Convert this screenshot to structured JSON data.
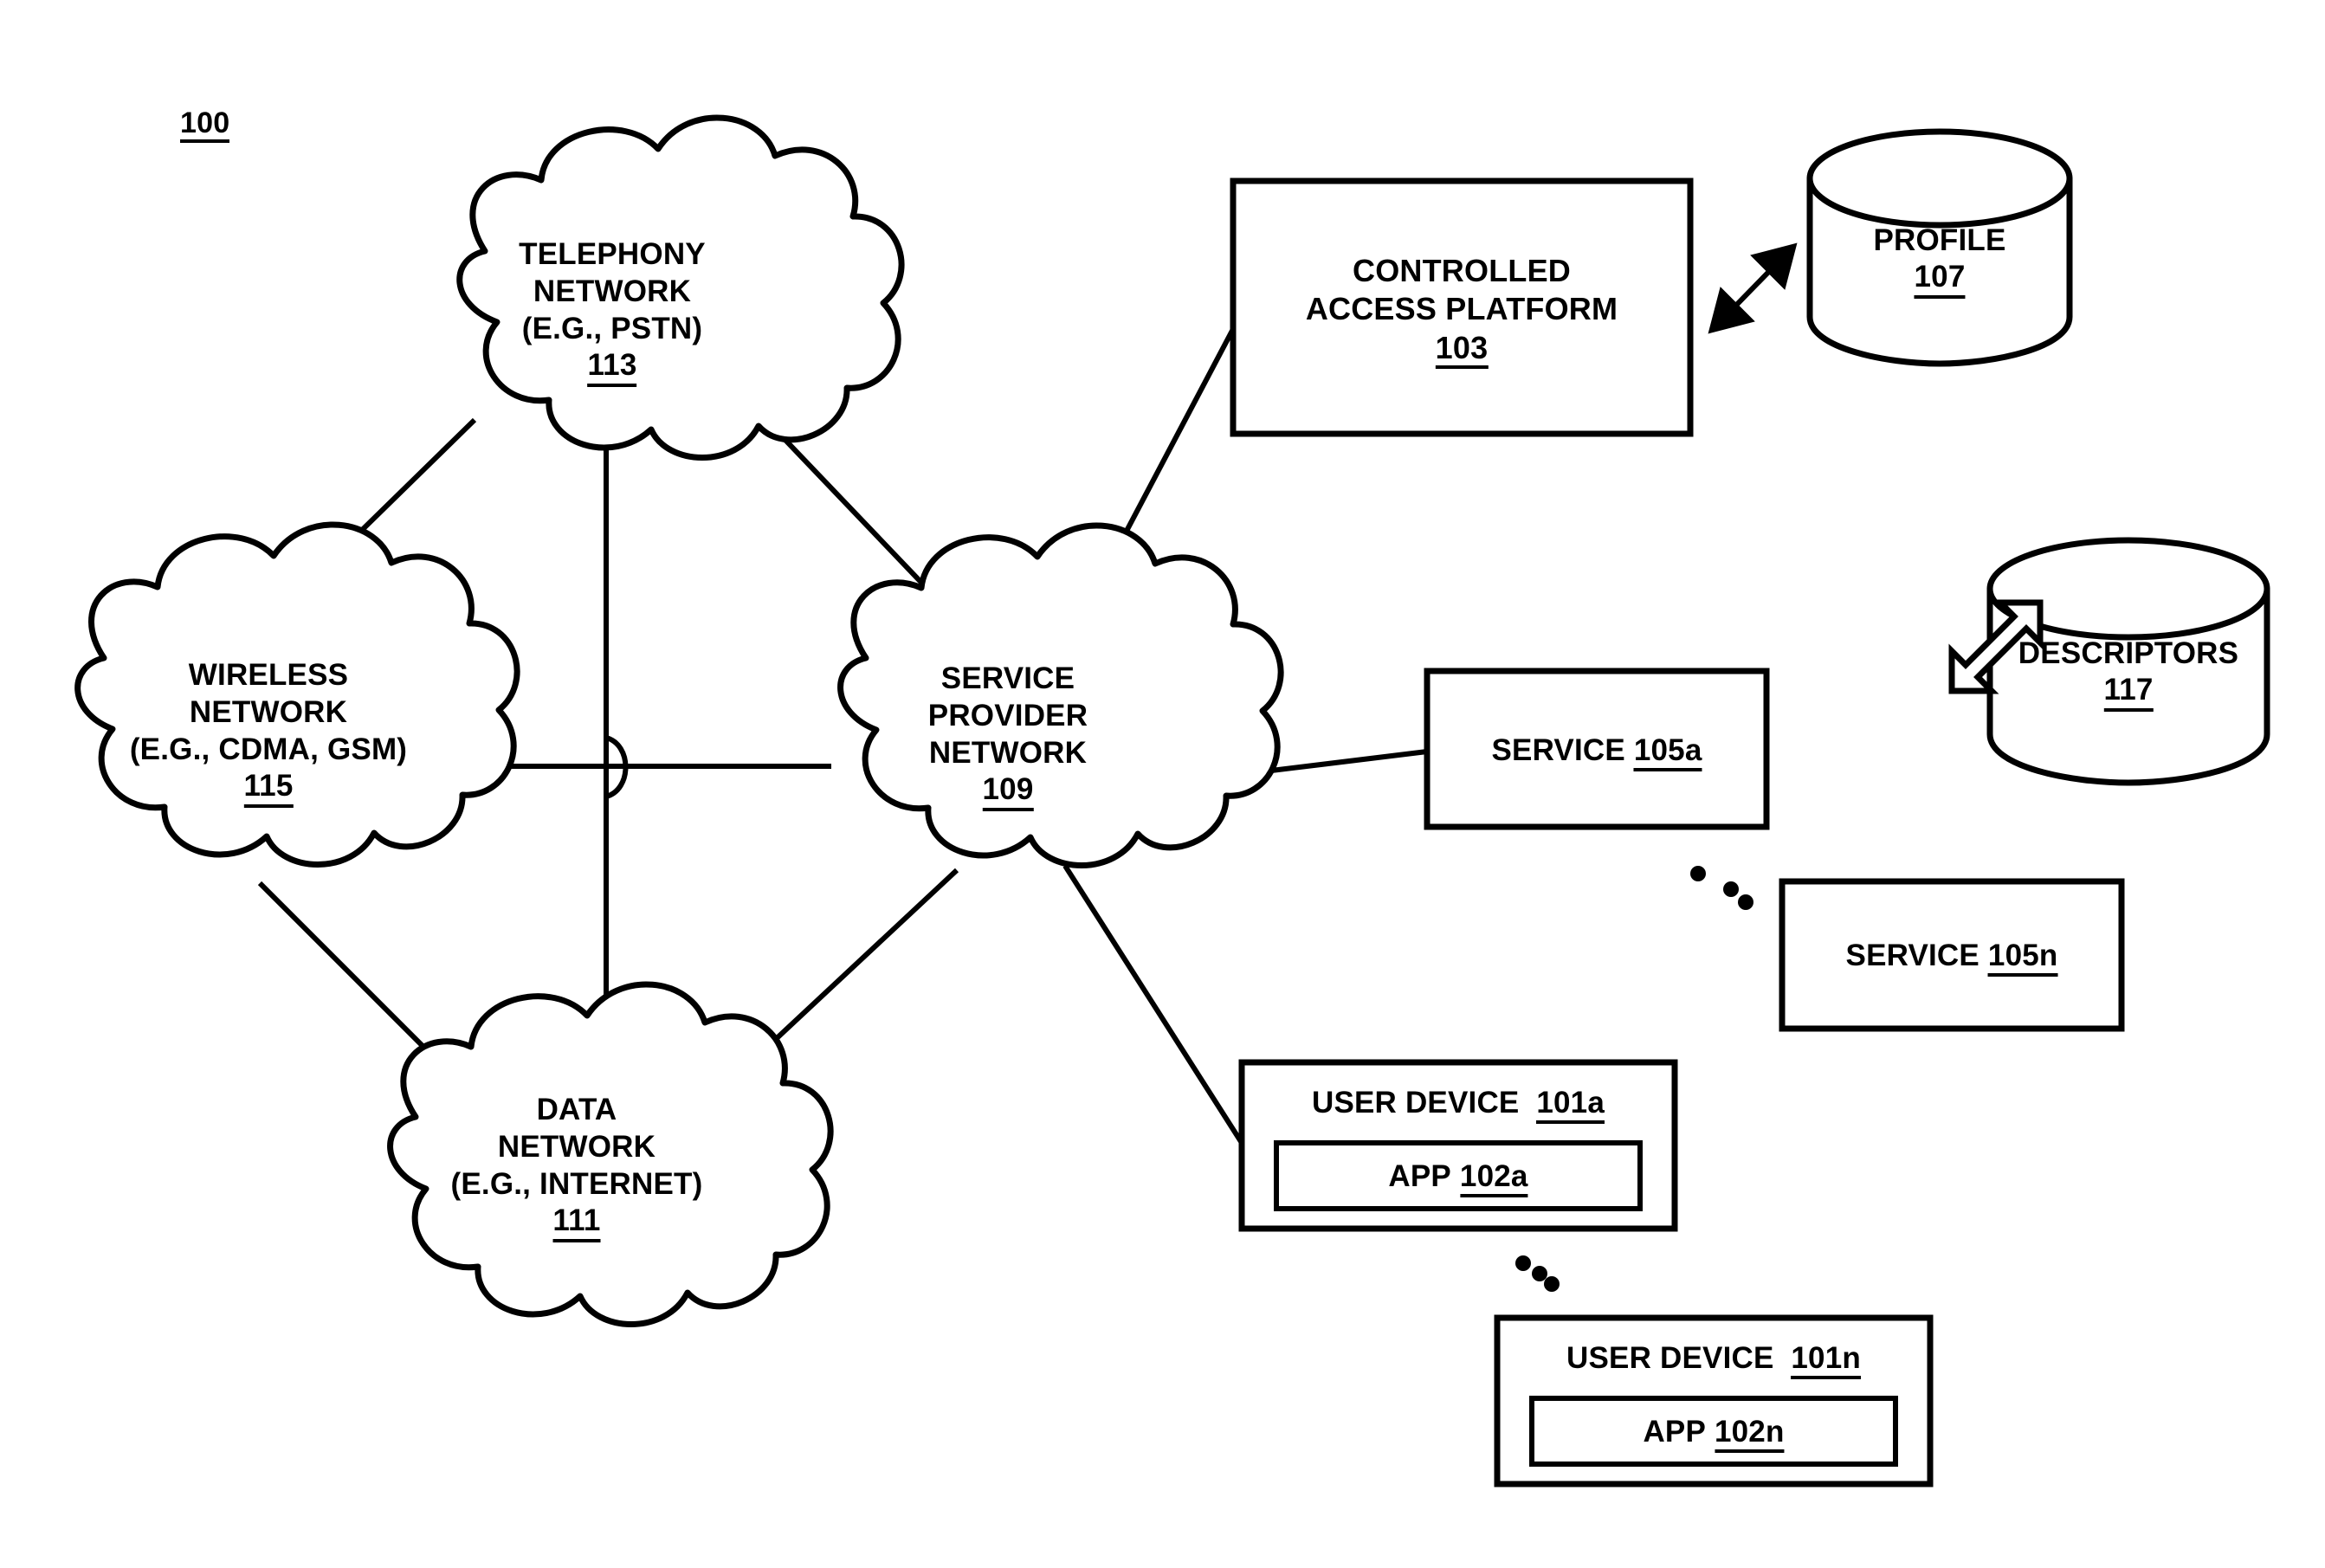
{
  "figure": {
    "number": "100",
    "type": "patent-network-diagram"
  },
  "clouds": [
    {
      "id": "telephony",
      "lines": [
        "TELEPHONY",
        "NETWORK",
        "(E.G., PSTN)"
      ],
      "ref": "113"
    },
    {
      "id": "wireless",
      "lines": [
        "WIRELESS",
        "NETWORK",
        "(E.G., CDMA, GSM)"
      ],
      "ref": "115"
    },
    {
      "id": "data",
      "lines": [
        "DATA",
        "NETWORK",
        "(E.G., INTERNET)"
      ],
      "ref": "111"
    },
    {
      "id": "service_provider",
      "lines": [
        "SERVICE",
        "PROVIDER",
        "NETWORK"
      ],
      "ref": "109"
    }
  ],
  "boxes": {
    "controlled_access_platform": {
      "lines": [
        "CONTROLLED",
        "ACCESS PLATFORM"
      ],
      "ref": "103"
    },
    "service_a": {
      "label": "SERVICE",
      "ref": "105a"
    },
    "service_n": {
      "label": "SERVICE",
      "ref": "105n"
    },
    "user_device_a": {
      "label": "USER DEVICE",
      "ref": "101a",
      "app_label": "APP",
      "app_ref": "102a"
    },
    "user_device_n": {
      "label": "USER DEVICE",
      "ref": "101n",
      "app_label": "APP",
      "app_ref": "102n"
    }
  },
  "databases": {
    "profile": {
      "label": "PROFILE",
      "ref": "107"
    },
    "descriptors": {
      "label": "DESCRIPTORS",
      "ref": "117"
    }
  },
  "ellipses": [
    {
      "id": "services-ellipsis"
    },
    {
      "id": "user-devices-ellipsis"
    }
  ],
  "connectors": [
    {
      "id": "telephony-wireless",
      "style": "plain-line"
    },
    {
      "id": "telephony-data",
      "style": "plain-line"
    },
    {
      "id": "telephony-service-provider",
      "style": "plain-line"
    },
    {
      "id": "wireless-service-provider",
      "style": "plain-line-with-hop"
    },
    {
      "id": "wireless-data",
      "style": "plain-line"
    },
    {
      "id": "data-service-provider",
      "style": "plain-line"
    },
    {
      "id": "service-provider-controlled-access-platform",
      "style": "plain-line"
    },
    {
      "id": "service-provider-service-a",
      "style": "plain-line"
    },
    {
      "id": "service-provider-user-device-a",
      "style": "plain-line"
    },
    {
      "id": "platform-profile",
      "style": "solid-double-arrow"
    },
    {
      "id": "service-a-descriptors",
      "style": "hollow-double-arrow"
    }
  ],
  "colors": {
    "ink": "#000000",
    "paper": "#ffffff"
  }
}
